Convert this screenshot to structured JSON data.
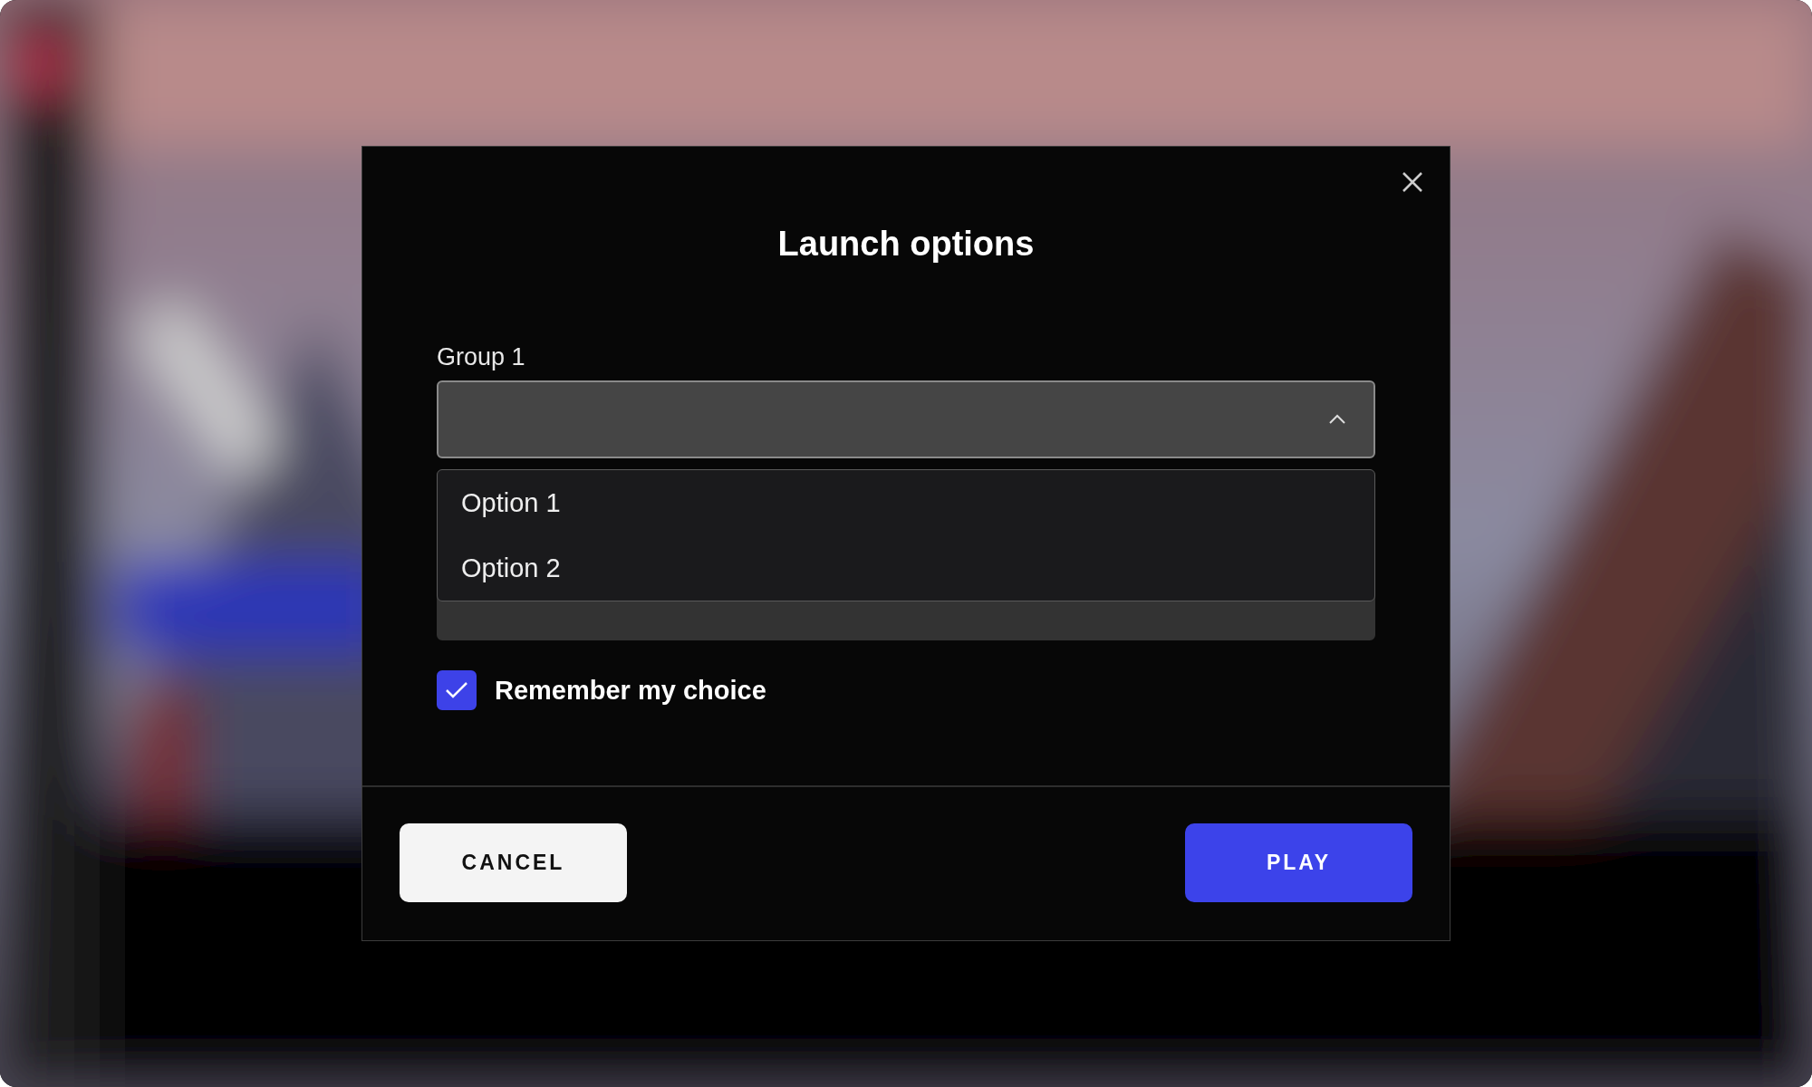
{
  "dialog": {
    "title": "Launch options"
  },
  "selects": [
    {
      "label": "Group 1",
      "expanded": true,
      "options": [
        {
          "label": "Option 1",
          "selected": false
        },
        {
          "label": "Option 2",
          "selected": false
        }
      ]
    },
    {
      "expanded": false
    }
  ],
  "checkbox": {
    "label": "Remember my choice",
    "checked": true
  },
  "buttons": [
    {
      "label": "CANCEL",
      "kind": "secondary"
    },
    {
      "label": "PLAY",
      "kind": "primary"
    }
  ]
}
